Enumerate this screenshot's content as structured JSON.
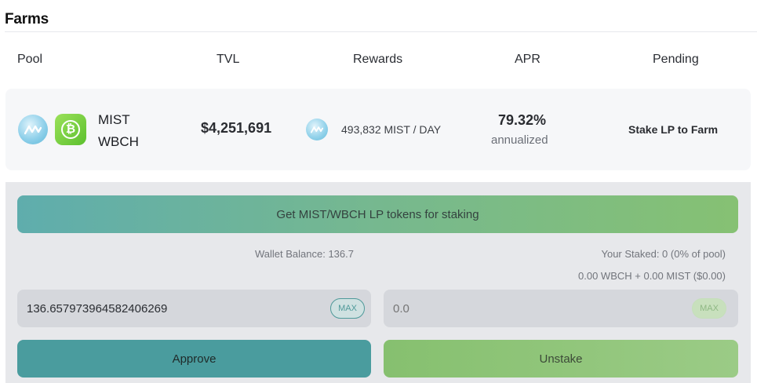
{
  "page": {
    "title": "Farms"
  },
  "columns": {
    "pool": "Pool",
    "tvl": "TVL",
    "rewards": "Rewards",
    "apr": "APR",
    "pending": "Pending"
  },
  "farm": {
    "token_a": "MIST",
    "token_b": "WBCH",
    "tvl": "$4,251,691",
    "rewards_rate": "493,832 MIST / DAY",
    "apr": "79.32%",
    "apr_label": "annualized",
    "pending": "Stake LP to Farm",
    "icons": {
      "token_a": "mist-token-icon",
      "token_b": "bitcoin-cash-icon",
      "reward": "mist-token-icon"
    }
  },
  "stake_panel": {
    "get_lp_label": "Get MIST/WBCH LP tokens for staking",
    "wallet_balance": "Wallet Balance: 136.7",
    "your_staked": "Your Staked: 0 (0% of pool)",
    "staked_value": "0.00 WBCH + 0.00 MIST ($0.00)",
    "stake_input_value": "136.657973964582406269",
    "unstake_input_placeholder": "0.0",
    "max_label": "MAX",
    "approve_label": "Approve",
    "unstake_label": "Unstake"
  },
  "colors": {
    "teal": "#4a9c9e",
    "green": "#86c06f",
    "panel": "#e7e8eb",
    "row": "#f6f7f9"
  }
}
